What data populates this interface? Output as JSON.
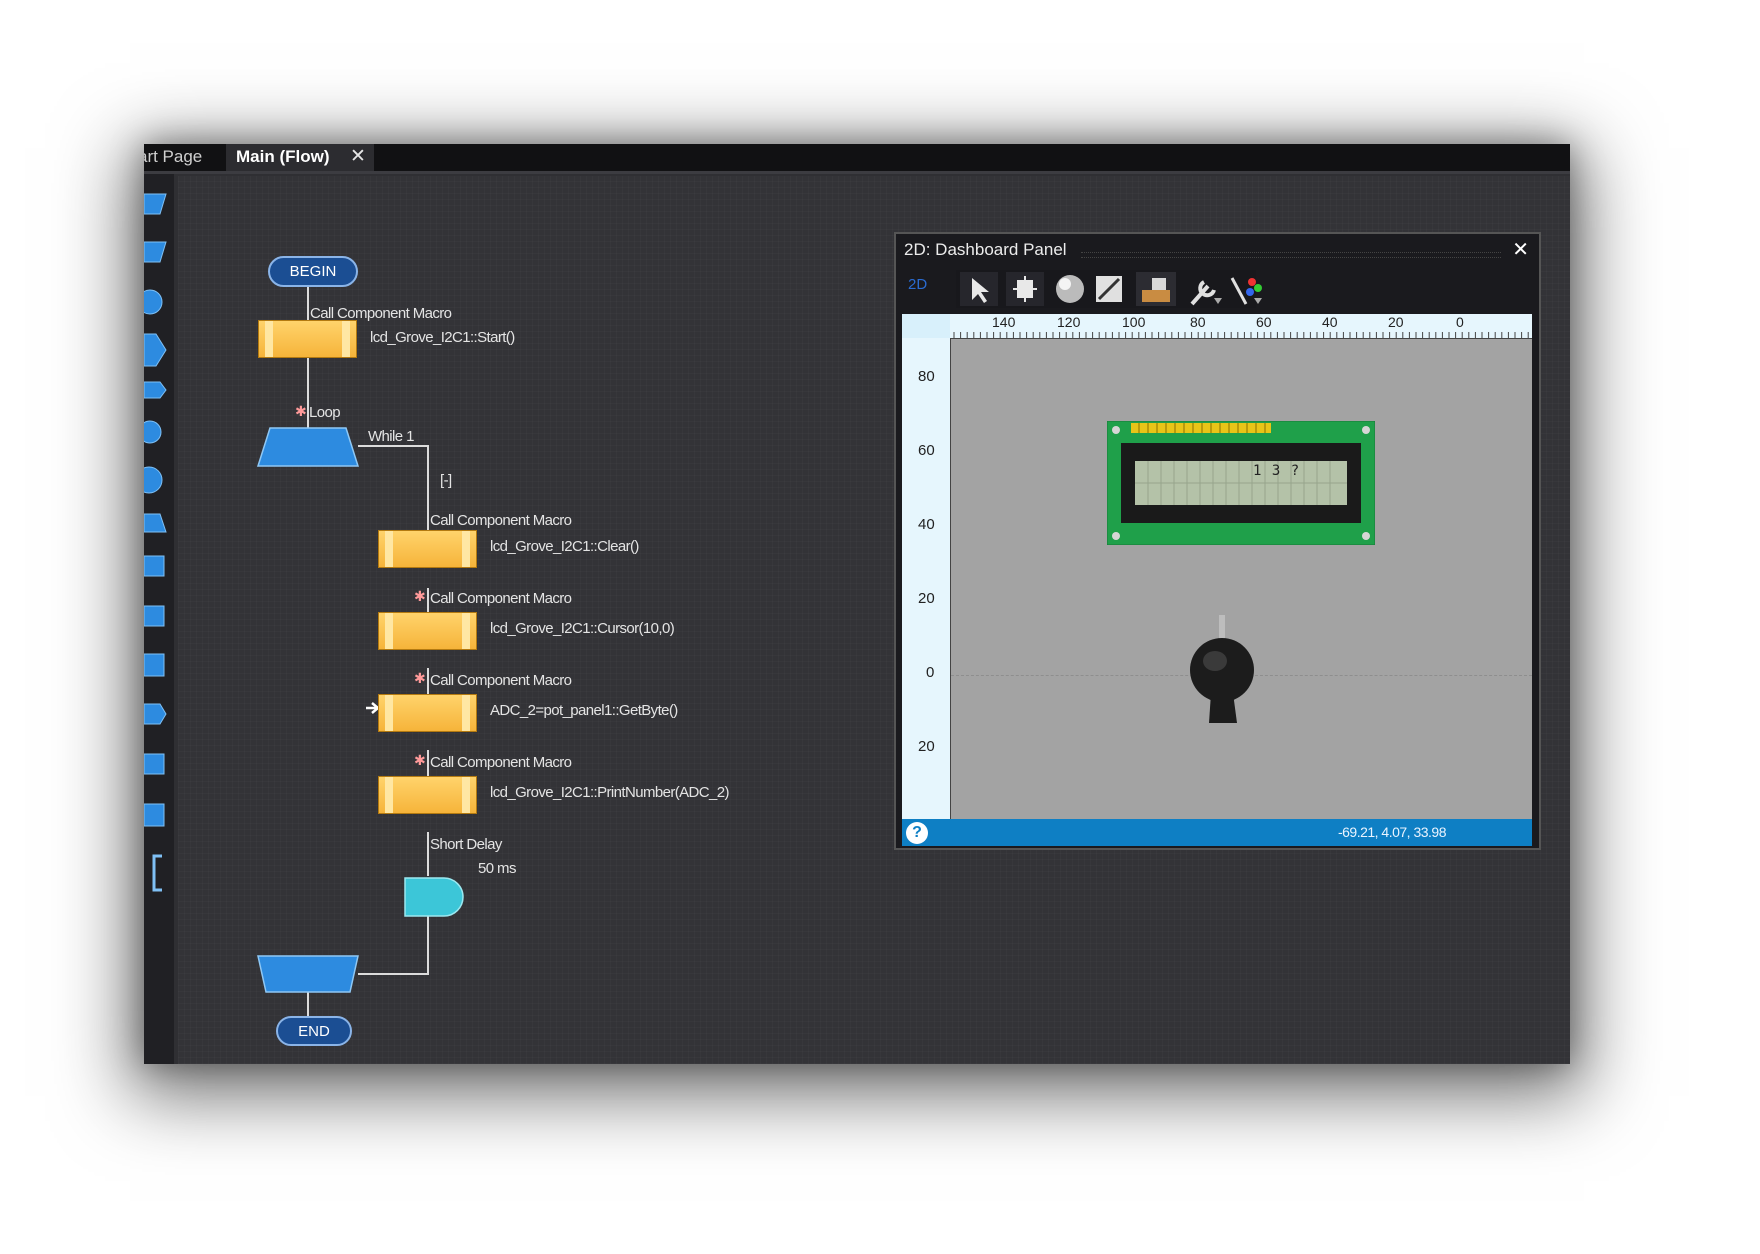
{
  "tabs": {
    "start_page": "art Page",
    "main_flow": "Main (Flow)",
    "close_glyph": "✕"
  },
  "flow": {
    "begin": "BEGIN",
    "end": "END",
    "macro1": {
      "type": "Call Component Macro",
      "text": "lcd_Grove_I2C1::Start()"
    },
    "loop": {
      "label": "Loop",
      "cond": "While 1",
      "collapse": "[-]"
    },
    "macro2": {
      "type": "Call Component Macro",
      "text": "lcd_Grove_I2C1::Clear()"
    },
    "macro3": {
      "type": "Call Component Macro",
      "text": "lcd_Grove_I2C1::Cursor(10,0)"
    },
    "macro4": {
      "type": "Call Component Macro",
      "text": "ADC_2=pot_panel1::GetByte()"
    },
    "macro5": {
      "type": "Call Component Macro",
      "text": "lcd_Grove_I2C1::PrintNumber(ADC_2)"
    },
    "delay": {
      "type": "Short Delay",
      "text": "50 ms"
    }
  },
  "dashboard": {
    "title": "2D: Dashboard Panel",
    "view_mode": "2D",
    "close_glyph": "✕",
    "tools": [
      "pointer-tool-icon",
      "move-tool-icon",
      "sphere-icon",
      "resize-icon",
      "layout-icon",
      "wrench-icon",
      "color-picker-icon"
    ],
    "ruler_x": [
      "140",
      "120",
      "100",
      "80",
      "60",
      "40",
      "20",
      "0"
    ],
    "ruler_y": [
      "80",
      "60",
      "40",
      "20",
      "0",
      "20"
    ],
    "lcd_text": "1 3 ?",
    "help": "?",
    "coords": "-69.21, 4.07, 33.98"
  },
  "colors": {
    "accent": "#0e7fc4",
    "macro": "#f6b43a",
    "loop": "#2d8be0",
    "terminal": "#1b4e93",
    "delay": "#3cc6d8"
  }
}
